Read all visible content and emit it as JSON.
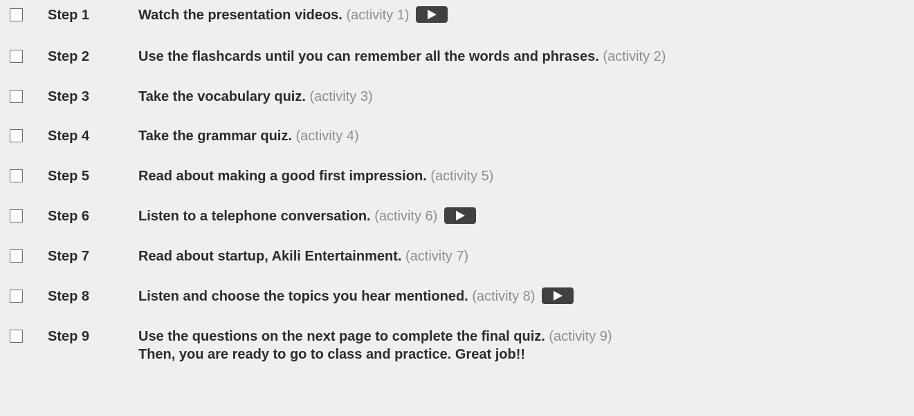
{
  "steps": [
    {
      "label": "Step 1",
      "text": "Watch the presentation videos.",
      "activity": "(activity 1)",
      "video": true
    },
    {
      "label": "Step 2",
      "text": "Use the flashcards until you can remember all the words and phrases.",
      "activity": "(activity 2)",
      "video": false
    },
    {
      "label": "Step 3",
      "text": "Take the vocabulary quiz.",
      "activity": "(activity 3)",
      "video": false
    },
    {
      "label": "Step 4",
      "text": "Take the grammar quiz.",
      "activity": "(activity 4)",
      "video": false
    },
    {
      "label": "Step 5",
      "text": "Read about making a good first impression.",
      "activity": "(activity 5)",
      "video": false
    },
    {
      "label": "Step 6",
      "text": "Listen to a telephone conversation.",
      "activity": "(activity 6)",
      "video": true
    },
    {
      "label": "Step 7",
      "text": "Read about startup, Akili Entertainment.",
      "activity": "(activity 7)",
      "video": false
    },
    {
      "label": "Step 8",
      "text": "Listen and choose the topics you hear mentioned.",
      "activity": "(activity 8)",
      "video": true
    },
    {
      "label": "Step 9",
      "text": "Use the questions on the next page to complete the final quiz.",
      "activity": "(activity 9)",
      "video": false,
      "continuation": "Then, you are ready to go to class and practice. Great job!!"
    }
  ],
  "icons": {
    "checkbox": "checkbox-icon",
    "play": "play-video-icon"
  },
  "colors": {
    "background": "#efefef",
    "text": "#2b2b2b",
    "activity": "#8e8e8e",
    "play_button": "#404040"
  }
}
